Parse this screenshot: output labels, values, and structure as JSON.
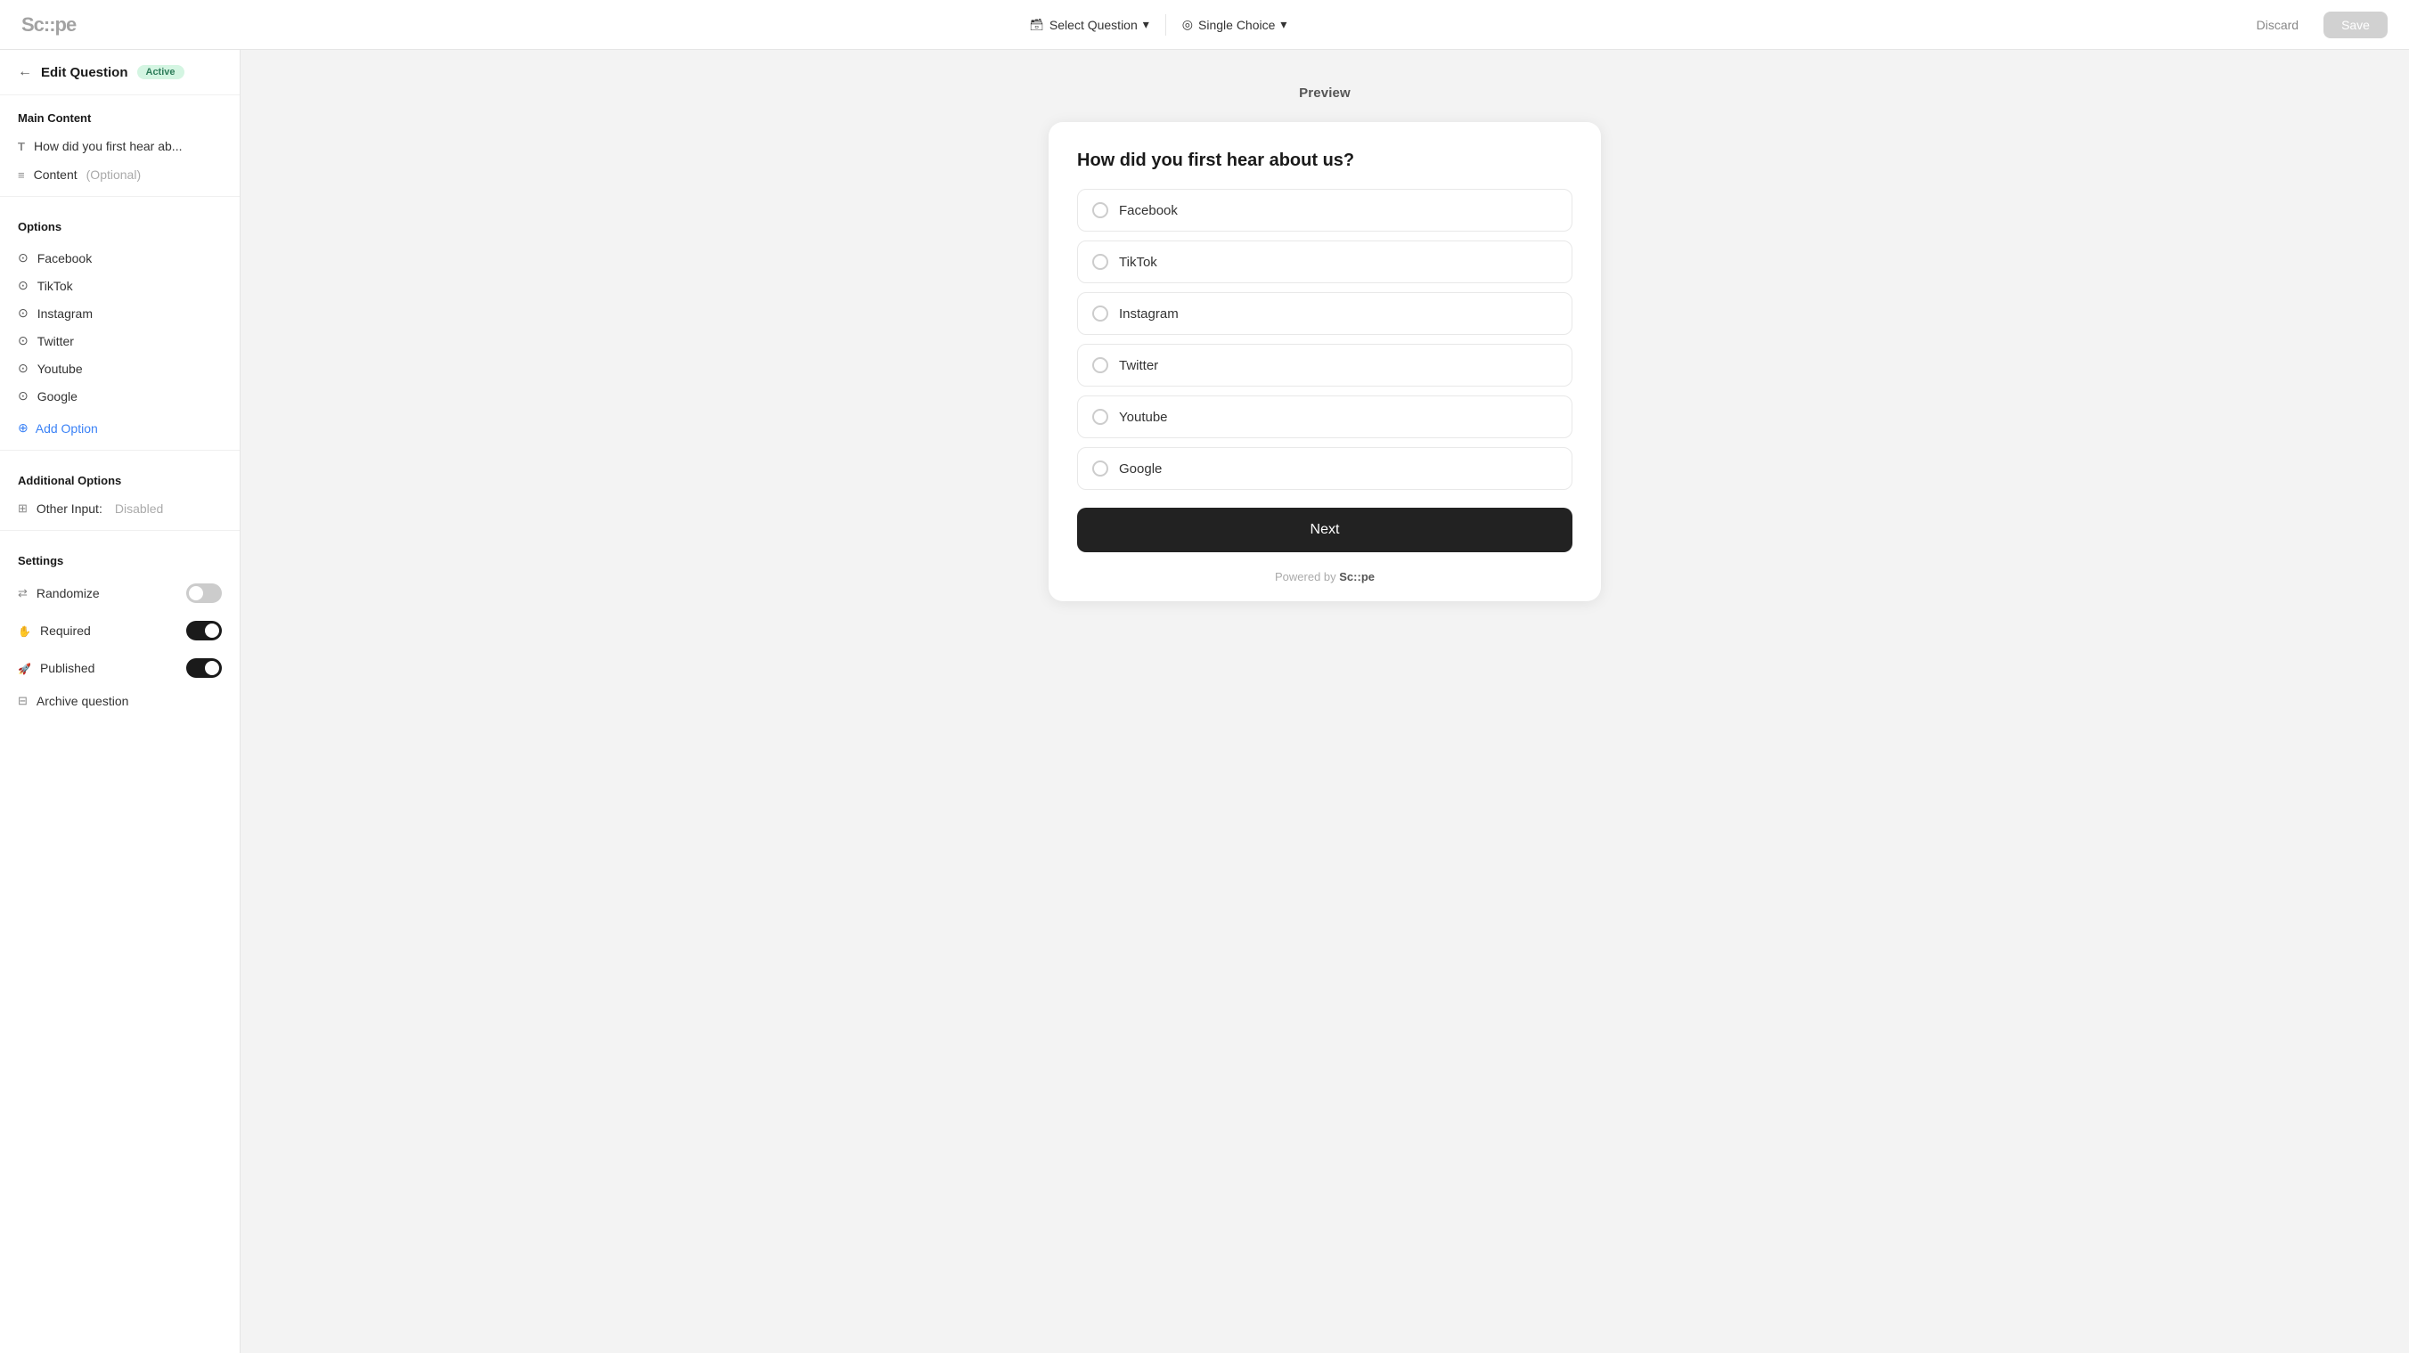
{
  "app": {
    "logo": "Sc::pe"
  },
  "topnav": {
    "select_question_label": "Select Question",
    "single_choice_label": "Single Choice",
    "discard_label": "Discard",
    "save_label": "Save"
  },
  "sidebar": {
    "header_title": "Edit Question",
    "header_badge": "Active",
    "main_content_label": "Main Content",
    "question_title_item": "How did you first hear ab...",
    "content_item": "Content",
    "content_optional": "(Optional)",
    "options_label": "Options",
    "options": [
      {
        "label": "Facebook"
      },
      {
        "label": "TikTok"
      },
      {
        "label": "Instagram"
      },
      {
        "label": "Twitter"
      },
      {
        "label": "Youtube"
      },
      {
        "label": "Google"
      }
    ],
    "add_option_label": "Add Option",
    "additional_options_label": "Additional Options",
    "other_input_label": "Other Input:",
    "other_input_value": "Disabled",
    "settings_label": "Settings",
    "randomize_label": "Randomize",
    "randomize_on": false,
    "required_label": "Required",
    "required_on": true,
    "published_label": "Published",
    "published_on": true,
    "archive_label": "Archive question"
  },
  "preview": {
    "label": "Preview",
    "question": "How did you first hear about us?",
    "options": [
      {
        "label": "Facebook"
      },
      {
        "label": "TikTok"
      },
      {
        "label": "Instagram"
      },
      {
        "label": "Twitter"
      },
      {
        "label": "Youtube"
      },
      {
        "label": "Google"
      }
    ],
    "next_button": "Next",
    "powered_by": "Powered by ",
    "powered_brand": "Sc::pe"
  }
}
